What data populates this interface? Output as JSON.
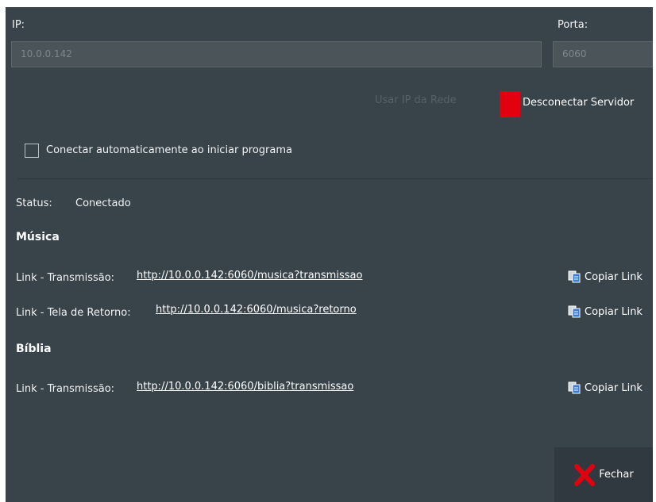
{
  "ip": {
    "label": "IP:",
    "value": "10.0.0.142"
  },
  "porta": {
    "label": "Porta:",
    "value": "6060"
  },
  "buttons": {
    "use_network_ip": "Usar IP da Rede",
    "disconnect": "Desconectar Servidor",
    "close": "Fechar"
  },
  "auto_connect": {
    "label": "Conectar automaticamente ao iniciar programa",
    "checked": false
  },
  "status": {
    "label": "Status:",
    "value": "Conectado"
  },
  "sections": [
    {
      "title": "Música",
      "links": [
        {
          "label": "Link - Transmissão:",
          "url": "http://10.0.0.142:6060/musica?transmissao",
          "copy": "Copiar Link"
        },
        {
          "label": "Link - Tela de Retorno:",
          "url": "http://10.0.0.142:6060/musica?retorno",
          "copy": "Copiar Link"
        }
      ]
    },
    {
      "title": "Bíblia",
      "links": [
        {
          "label": "Link - Transmissão:",
          "url": "http://10.0.0.142:6060/biblia?transmissao",
          "copy": "Copiar Link"
        }
      ]
    }
  ],
  "colors": {
    "background": "#38434a",
    "accent_red": "#e3000f",
    "field_bg": "#4a5459"
  },
  "icons": {
    "copy": "copy-icon",
    "close": "close-x-icon"
  }
}
